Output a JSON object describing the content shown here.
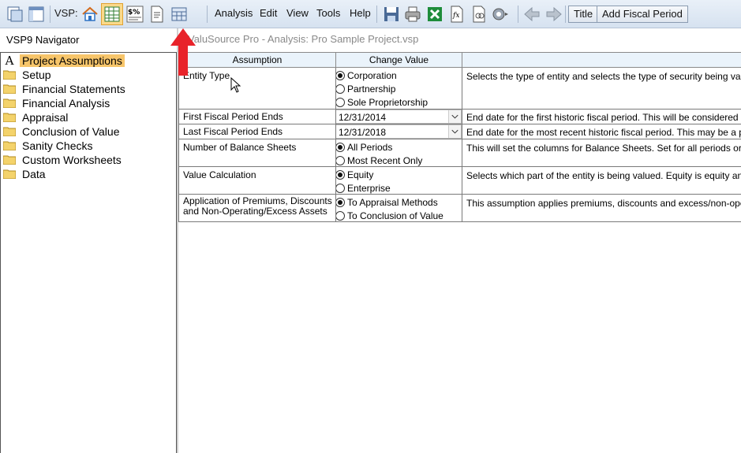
{
  "toolbar": {
    "vsp_label": "VSP:",
    "menus": [
      "Analysis",
      "Edit",
      "View",
      "Tools",
      "Help"
    ],
    "title_button": "Title",
    "add_period_button": "Add Fiscal Period"
  },
  "navigator": {
    "title": "VSP9 Navigator",
    "items": [
      {
        "label": "Project Assumptions",
        "selected": true,
        "icon": "letter-a-icon"
      },
      {
        "label": "Setup",
        "icon": "folder-icon"
      },
      {
        "label": "Financial Statements",
        "icon": "folder-icon"
      },
      {
        "label": "Financial Analysis",
        "icon": "folder-icon"
      },
      {
        "label": "Appraisal",
        "icon": "folder-icon"
      },
      {
        "label": "Conclusion of Value",
        "icon": "folder-icon"
      },
      {
        "label": "Sanity Checks",
        "icon": "folder-icon"
      },
      {
        "label": "Custom Worksheets",
        "icon": "folder-icon"
      },
      {
        "label": "Data",
        "icon": "folder-icon"
      }
    ]
  },
  "document": {
    "tab_title": "ValuSource Pro - Analysis: Pro Sample Project.vsp"
  },
  "grid": {
    "headers": {
      "assumption": "Assumption",
      "change_value": "Change Value",
      "description": ""
    },
    "rows": [
      {
        "assumption": "Entity Type",
        "options": [
          {
            "label": "Corporation",
            "checked": true
          },
          {
            "label": "Partnership",
            "checked": false
          },
          {
            "label": "Sole Proprietorship",
            "checked": false
          }
        ],
        "description": "Selects the type of entity and selects the type of security being valued,"
      },
      {
        "assumption": "First Fiscal Period Ends",
        "value": "12/31/2014",
        "description": "End date for the first historic fiscal period.  This will be considered a fu"
      },
      {
        "assumption": "Last Fiscal Period Ends",
        "value": "12/31/2018",
        "description": "End date for the most recent historic fiscal period.  This may be a partia"
      },
      {
        "assumption": "Number of Balance Sheets",
        "options": [
          {
            "label": "All Periods",
            "checked": true
          },
          {
            "label": "Most Recent Only",
            "checked": false
          }
        ],
        "description": "This will set the columns for Balance Sheets.  Set for all periods or only"
      },
      {
        "assumption": "Value Calculation",
        "options": [
          {
            "label": "Equity",
            "checked": true
          },
          {
            "label": "Enterprise",
            "checked": false
          }
        ],
        "description": "Selects which part of the entity is being valued. Equity is equity and En"
      },
      {
        "assumption_lines": [
          "Application of Premiums, Discounts",
          "and Non-Operating/Excess Assets"
        ],
        "options": [
          {
            "label": "To Appraisal Methods",
            "checked": true
          },
          {
            "label": "To Conclusion of Value",
            "checked": false
          }
        ],
        "description": "This assumption applies premiums, discounts and excess/non-operati"
      }
    ]
  },
  "colors": {
    "toolbar_bg": "#dfe8f3",
    "selected_nav_bg": "#f7c56a",
    "header_bg": "#eaf3fb",
    "arrow": "#e8232a"
  }
}
